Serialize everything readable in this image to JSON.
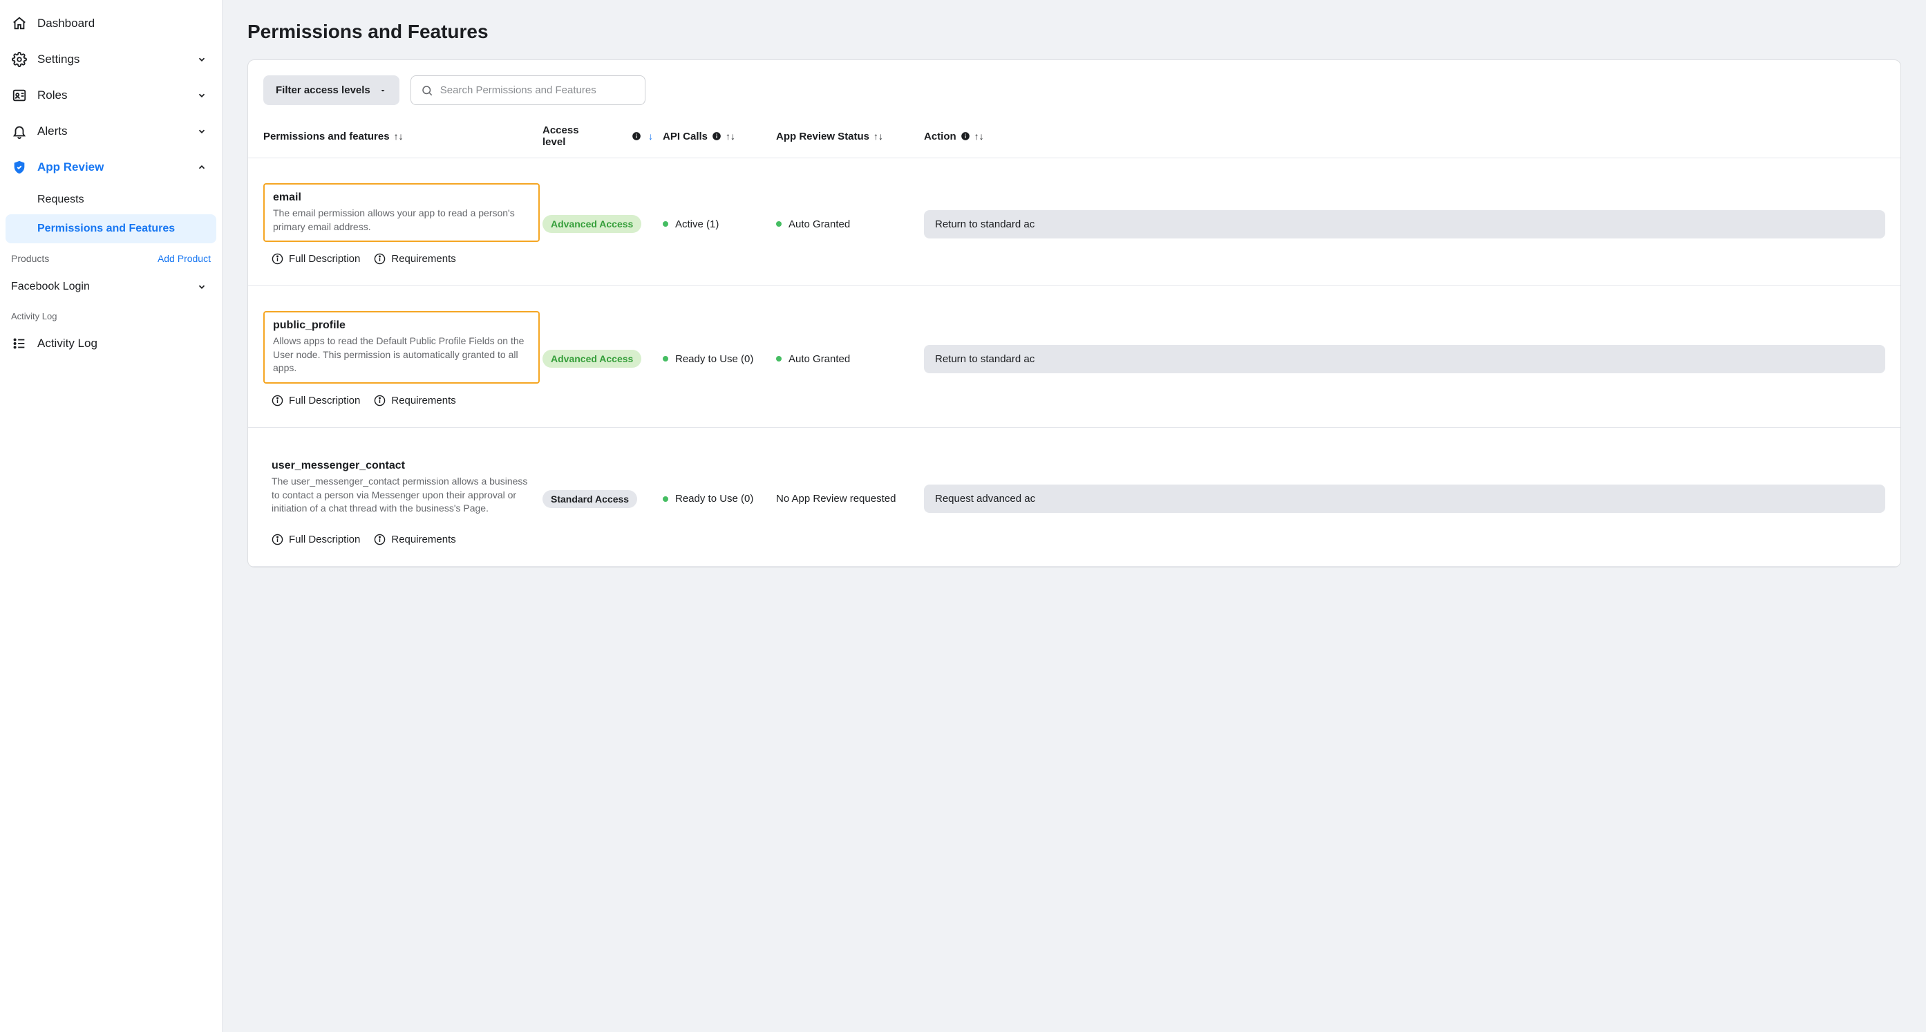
{
  "sidebar": {
    "dashboard": "Dashboard",
    "settings": "Settings",
    "roles": "Roles",
    "alerts": "Alerts",
    "app_review": "App Review",
    "app_review_sub": {
      "requests": "Requests",
      "permissions": "Permissions and Features"
    },
    "products_label": "Products",
    "add_product": "Add Product",
    "facebook_login": "Facebook Login",
    "activity_log_label": "Activity Log",
    "activity_log": "Activity Log"
  },
  "page": {
    "title": "Permissions and Features",
    "filter_label": "Filter access levels",
    "search_placeholder": "Search Permissions and Features"
  },
  "columns": {
    "perm": "Permissions and features",
    "access": "Access level",
    "api": "API Calls",
    "review": "App Review Status",
    "action": "Action"
  },
  "links": {
    "full_description": "Full Description",
    "requirements": "Requirements"
  },
  "badges": {
    "advanced": "Advanced Access",
    "standard": "Standard Access"
  },
  "rows": [
    {
      "name": "email",
      "desc": "The email permission allows your app to read a person's primary email address.",
      "highlight": true,
      "access": "advanced",
      "api": "Active (1)",
      "api_dot": true,
      "review": "Auto Granted",
      "review_dot": true,
      "action": "Return to standard ac"
    },
    {
      "name": "public_profile",
      "desc": "Allows apps to read the Default Public Profile Fields on the User node. This permission is automatically granted to all apps.",
      "highlight": true,
      "access": "advanced",
      "api": "Ready to Use (0)",
      "api_dot": true,
      "review": "Auto Granted",
      "review_dot": true,
      "action": "Return to standard ac"
    },
    {
      "name": "user_messenger_contact",
      "desc": "The user_messenger_contact permission allows a business to contact a person via Messenger upon their approval or initiation of a chat thread with the business's Page.",
      "highlight": false,
      "access": "standard",
      "api": "Ready to Use (0)",
      "api_dot": true,
      "review": "No App Review requested",
      "review_dot": false,
      "action": "Request advanced ac"
    }
  ]
}
